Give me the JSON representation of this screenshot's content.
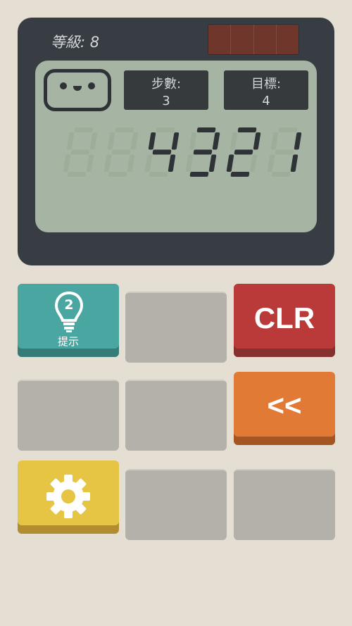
{
  "header": {
    "level_text": "等級: 8"
  },
  "stats": {
    "moves_label": "步數:",
    "moves_value": "3",
    "goal_label": "目標:",
    "goal_value": "4"
  },
  "display": {
    "value": "4321"
  },
  "buttons": {
    "hint_label": "提示",
    "hint_count": "2",
    "clear_label": "CLR",
    "back_label": "<<"
  },
  "colors": {
    "hint": "#4aa6a1",
    "clear": "#b93a39",
    "back": "#e17a34",
    "settings": "#e6c544",
    "empty_key": "#b3b1aa"
  },
  "icons": {
    "hint": "lightbulb-icon",
    "settings": "gear-icon",
    "mascot": "calculator-face-icon"
  }
}
